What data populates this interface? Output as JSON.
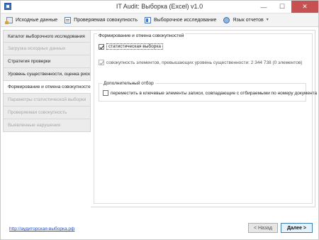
{
  "window": {
    "title": "IT Audit: Выборка (Excel) v1.0"
  },
  "toolbar": {
    "items": [
      {
        "label": "Исходные данные",
        "icon": "source-data-icon",
        "dropdown": false
      },
      {
        "label": "Проверяемая совокупность",
        "icon": "population-icon",
        "dropdown": false
      },
      {
        "label": "Выборочное исследование",
        "icon": "sample-study-icon",
        "dropdown": false
      },
      {
        "label": "Язык отчетов",
        "icon": "language-icon",
        "dropdown": true
      }
    ]
  },
  "sidebar": {
    "items": [
      {
        "label": "Каталог выборочного исследования",
        "state": "normal"
      },
      {
        "label": "Загрузка исходных данных",
        "state": "disabled"
      },
      {
        "label": "Стратегия проверки",
        "state": "normal"
      },
      {
        "label": "Уровень существенности, оценка риска",
        "state": "normal"
      },
      {
        "label": "Формирование и отмена совокупностей",
        "state": "active"
      },
      {
        "label": "Параметры статистической выборки",
        "state": "disabled"
      },
      {
        "label": "Проверяемая совокупность",
        "state": "disabled"
      },
      {
        "label": "Выявленные нарушения",
        "state": "disabled"
      }
    ]
  },
  "main": {
    "group_title": "Формирование и отмена совокупностей",
    "statistical_sample": {
      "label": "статистическая выборка",
      "checked": true
    },
    "material_items": {
      "label": "совокупность элементов, превышающих уровень существенности: 2 344 738 (0 элементов)",
      "checked": true
    },
    "extra_selection": {
      "title": "Дополнительный отбор",
      "move_keys": {
        "label": "переместить в ключевые элементы записи, совпадающие с отбираемыми по номеру документа",
        "checked": false
      }
    }
  },
  "footer": {
    "link": "http://аудиторская-выборка.рф",
    "back_label": "< Назад",
    "next_label": "Далее >"
  }
}
